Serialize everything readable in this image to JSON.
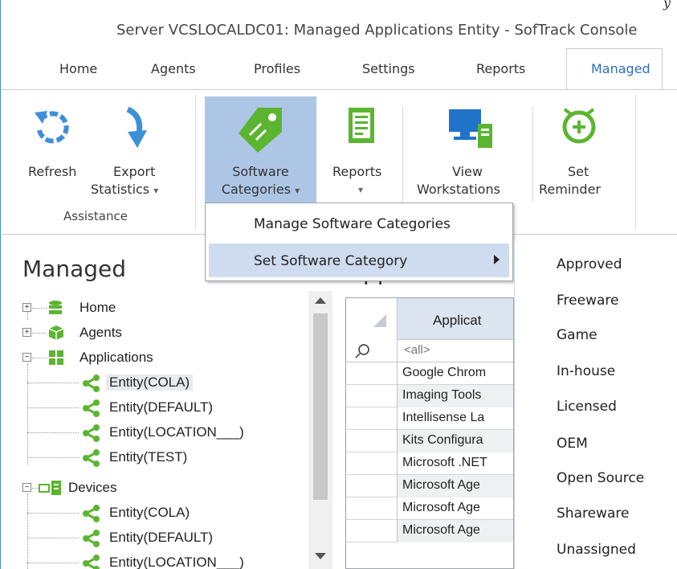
{
  "window": {
    "title": "Server VCSLOCALDC01: Managed Applications Entity - SofTrack Console",
    "corner_glyph": "y"
  },
  "tabs": [
    {
      "label": "Home"
    },
    {
      "label": "Agents"
    },
    {
      "label": "Profiles"
    },
    {
      "label": "Settings"
    },
    {
      "label": "Reports"
    },
    {
      "label": "Managed",
      "active": true
    }
  ],
  "ribbon": {
    "refresh_label": "Refresh",
    "export_label_1": "Export",
    "export_label_2": "Statistics",
    "group_assistance": "Assistance",
    "software_label_1": "Software",
    "software_label_2": "Categories",
    "reports_label": "Reports",
    "view_label_1": "View",
    "view_label_2": "Workstations",
    "set_label_1": "Set",
    "set_label_2": "Reminder",
    "dropdown_glyph": "▾"
  },
  "dropdown": {
    "items": [
      "Manage Software Categories",
      "Set Software Category"
    ]
  },
  "submenu": {
    "items": [
      "Approved",
      "Freeware",
      "Game",
      "In-house",
      "Licensed",
      "OEM",
      "Open Source",
      "Shareware",
      "Unassigned"
    ]
  },
  "left_panel": {
    "title": "Managed",
    "tree": [
      {
        "label": "Home",
        "icon": "database-icon",
        "level": 0,
        "expander": "+"
      },
      {
        "label": "Agents",
        "icon": "cube-icon",
        "level": 0,
        "expander": "+"
      },
      {
        "label": "Applications",
        "icon": "grid-icon",
        "level": 0,
        "expander": "−"
      },
      {
        "label": "Entity(COLA)",
        "icon": "share-icon",
        "level": 1,
        "selected": true
      },
      {
        "label": "Entity(DEFAULT)",
        "icon": "share-icon",
        "level": 1
      },
      {
        "label": "Entity(LOCATION___)",
        "icon": "share-icon",
        "level": 1
      },
      {
        "label": "Entity(TEST)",
        "icon": "share-icon",
        "level": 1
      },
      {
        "label": "Devices",
        "icon": "devices-icon",
        "level": 0,
        "expander": "−"
      },
      {
        "label": "Entity(COLA)",
        "icon": "share-icon",
        "level": 1
      },
      {
        "label": "Entity(DEFAULT)",
        "icon": "share-icon",
        "level": 1
      },
      {
        "label": "Entity(LOCATION___)",
        "icon": "share-icon",
        "level": 1
      }
    ]
  },
  "pane_title_fragment": "pp",
  "grid": {
    "header": "Applicat",
    "filter": "<all>",
    "rows": [
      "Google Chrom",
      "Imaging Tools",
      "Intellisense La",
      "Kits Configura",
      "Microsoft .NET",
      "Microsoft Age",
      "Microsoft Age",
      "Microsoft Age"
    ]
  },
  "colors": {
    "accent": "#2b6fb9",
    "pressed": "#adc6e6",
    "highlight": "#cfdcf0",
    "icon_green": "#5cb531",
    "icon_blue": "#3d8fd9"
  }
}
